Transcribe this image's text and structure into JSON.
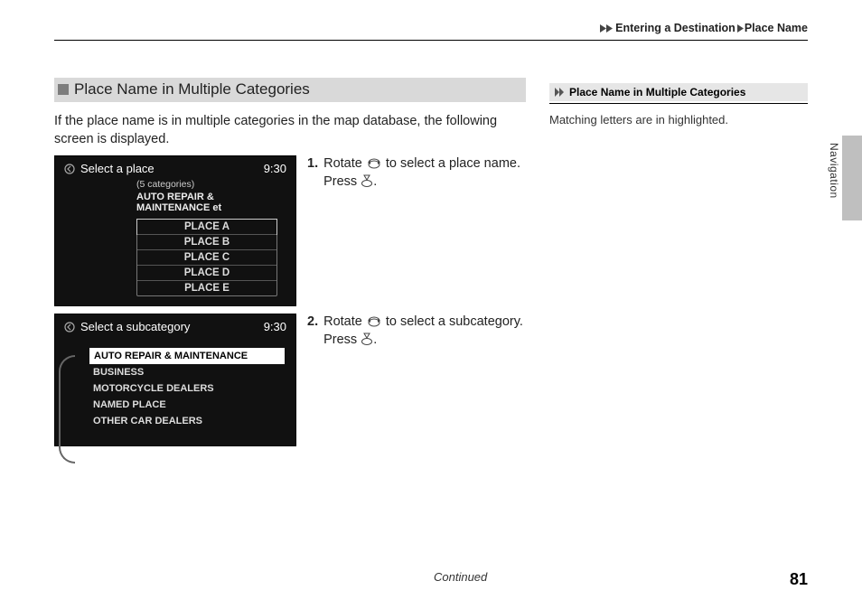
{
  "breadcrumb": {
    "seg1": "Entering a Destination",
    "seg2": "Place Name"
  },
  "section": {
    "title": "Place Name in Multiple Categories"
  },
  "intro": "If the place name is in multiple categories in the map database, the following screen is displayed.",
  "screen1": {
    "title": "Select a place",
    "time": "9:30",
    "count": "(5 categories)",
    "category": "AUTO REPAIR & MAINTENANCE et",
    "items": [
      "PLACE A",
      "PLACE B",
      "PLACE C",
      "PLACE D",
      "PLACE E"
    ]
  },
  "screen2": {
    "title": "Select a subcategory",
    "time": "9:30",
    "items": [
      "AUTO REPAIR & MAINTENANCE",
      "BUSINESS",
      "MOTORCYCLE DEALERS",
      "NAMED PLACE",
      "OTHER CAR DEALERS"
    ]
  },
  "steps": {
    "s1": {
      "num": "1.",
      "rotate_pre": "Rotate ",
      "rotate_post": " to select a place name.",
      "press_pre": "Press ",
      "press_post": "."
    },
    "s2": {
      "num": "2.",
      "rotate_pre": "Rotate ",
      "rotate_post": " to select a subcategory.",
      "press_pre": "Press ",
      "press_post": "."
    }
  },
  "side": {
    "title": "Place Name in Multiple Categories",
    "note": "Matching letters are in highlighted."
  },
  "nav_label": "Navigation",
  "footer": {
    "continued": "Continued",
    "page": "81"
  }
}
